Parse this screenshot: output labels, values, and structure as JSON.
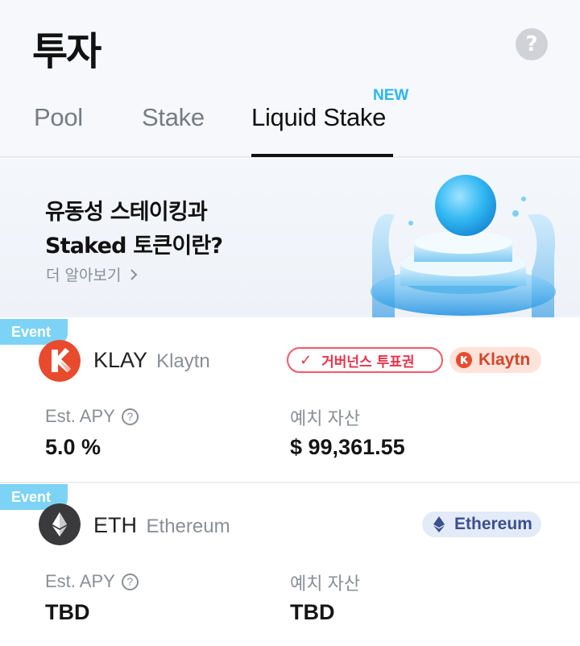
{
  "header": {
    "title": "투자",
    "help_icon_glyph": "?",
    "tabs": [
      {
        "label": "Pool",
        "active": false
      },
      {
        "label": "Stake",
        "active": false
      },
      {
        "label": "Liquid Stake",
        "active": true
      }
    ],
    "new_badge": "NEW"
  },
  "banner": {
    "title": "유동성 스테이킹과\nStaked 토큰이란?",
    "link": "더 알아보기"
  },
  "cards": [
    {
      "event_badge": "Event",
      "symbol": "KLAY",
      "chain": "Klaytn",
      "governance_pill": "거버넌스 투표권",
      "network_pill": "Klaytn",
      "apy_label": "Est. APY",
      "apy_value": "5.0 %",
      "deposit_label": "예치 자산",
      "deposit_value": "$ 99,361.55"
    },
    {
      "event_badge": "Event",
      "symbol": "ETH",
      "chain": "Ethereum",
      "network_pill": "Ethereum",
      "apy_label": "Est. APY",
      "apy_value": "TBD",
      "deposit_label": "예치 자산",
      "deposit_value": "TBD"
    }
  ],
  "colors": {
    "accent_new": "#29b6f6",
    "event_badge": "#7dd3f5",
    "governance": "#e8334a",
    "klaytn": "#d2462c",
    "ethereum": "#3c4f8f"
  },
  "icons": {
    "help": "question-icon",
    "klay_logo": "klaytn-logo-icon",
    "eth_logo": "ethereum-logo-icon",
    "info": "question-circle-icon",
    "check": "check-icon",
    "chevron": "chevron-right-icon"
  }
}
